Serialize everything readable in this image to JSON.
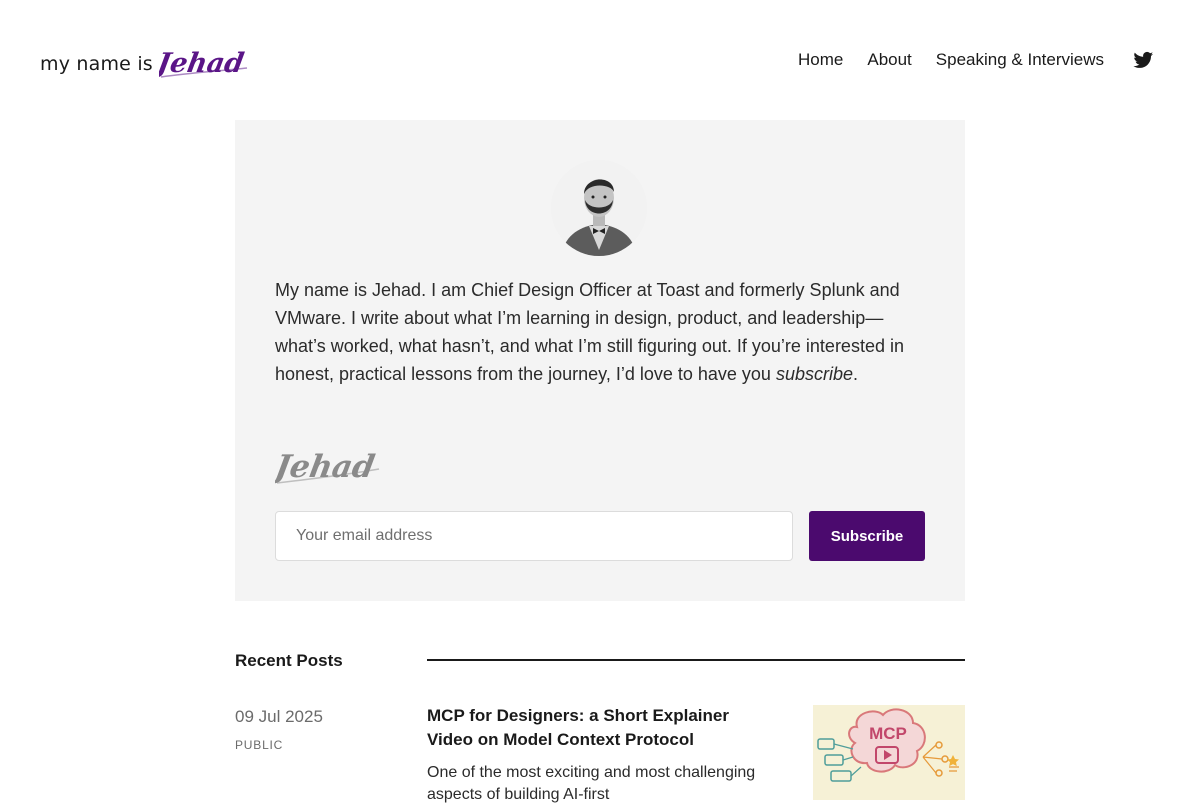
{
  "header": {
    "logo_text": "my name is",
    "logo_signature": "Jehad",
    "nav": [
      "Home",
      "About",
      "Speaking & Interviews"
    ],
    "social_icon": "twitter-icon"
  },
  "intro": {
    "text_before": "My name is Jehad. I am Chief Design Officer at Toast and formerly Splunk and VMware. I write about what I’m learning in design, product, and leadership—what’s worked, what hasn’t, and what I’m still figuring out. If you’re interested in honest, practical lessons from the journey, I’d love to have you ",
    "emphasis": "subscribe",
    "text_after": ".",
    "signature": "Jehad"
  },
  "subscribe_form": {
    "placeholder": "Your email address",
    "value": "",
    "button_label": "Subscribe"
  },
  "recent_posts": {
    "title": "Recent Posts",
    "posts": [
      {
        "date": "09 Jul 2025",
        "access": "PUBLIC",
        "title": "MCP for Designers: a Short Explainer Video on Model Context Protocol",
        "excerpt": "One of the most exciting and most challenging aspects of building AI-first",
        "thumbnail_label": "MCP"
      }
    ]
  },
  "colors": {
    "accent": "#4b0a6e",
    "card_background": "#f4f4f4",
    "signature_purple": "#5a1587",
    "signature_gray": "#8a8a8a"
  }
}
